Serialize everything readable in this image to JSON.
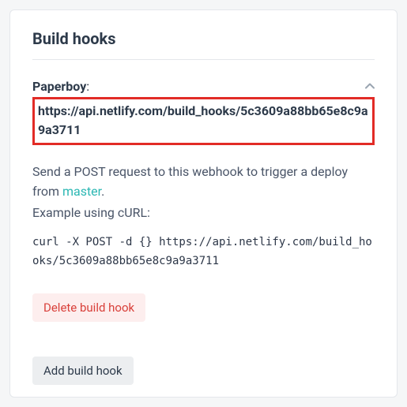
{
  "title": "Build hooks",
  "hook": {
    "name": "Paperboy",
    "url": "https://api.netlify.com/build_hooks/5c3609a88bb65e8c9a9a3711",
    "desc_prefix": "Send a POST request to this webhook to trigger a deploy from ",
    "branch": "master",
    "desc_suffix": ".",
    "example_label": "Example using cURL:",
    "curl": "curl -X POST -d {} https://api.netlify.com/build_hooks/5c3609a88bb65e8c9a9a3711",
    "delete_label": "Delete build hook"
  },
  "add_label": "Add build hook"
}
